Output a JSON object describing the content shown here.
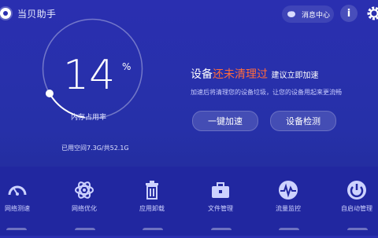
{
  "header": {
    "title": "当贝助手",
    "message_label": "消息中心",
    "info_label": "i"
  },
  "memory": {
    "percent": "14",
    "percent_sign": "%",
    "label": "内存占用率",
    "usage_fraction": 0.14,
    "space_text": "已用空间7.3G/共52.1G"
  },
  "notice": {
    "prefix": "设备",
    "highlight": "还未清理过",
    "suffix": "建议立即加速",
    "subtitle": "加速后将清理您的设备垃圾，让您的设备用起来更流畅",
    "highlight_color": "#ff6b3d"
  },
  "actions": {
    "boost": "一键加速",
    "detect": "设备检测"
  },
  "tools": [
    {
      "label": "网络测速",
      "icon": "speedometer-icon"
    },
    {
      "label": "网络优化",
      "icon": "atom-icon"
    },
    {
      "label": "应用卸载",
      "icon": "trash-icon"
    },
    {
      "label": "文件管理",
      "icon": "toolbox-icon"
    },
    {
      "label": "流量监控",
      "icon": "pulse-icon"
    },
    {
      "label": "自启动管理",
      "icon": "power-icon"
    }
  ]
}
